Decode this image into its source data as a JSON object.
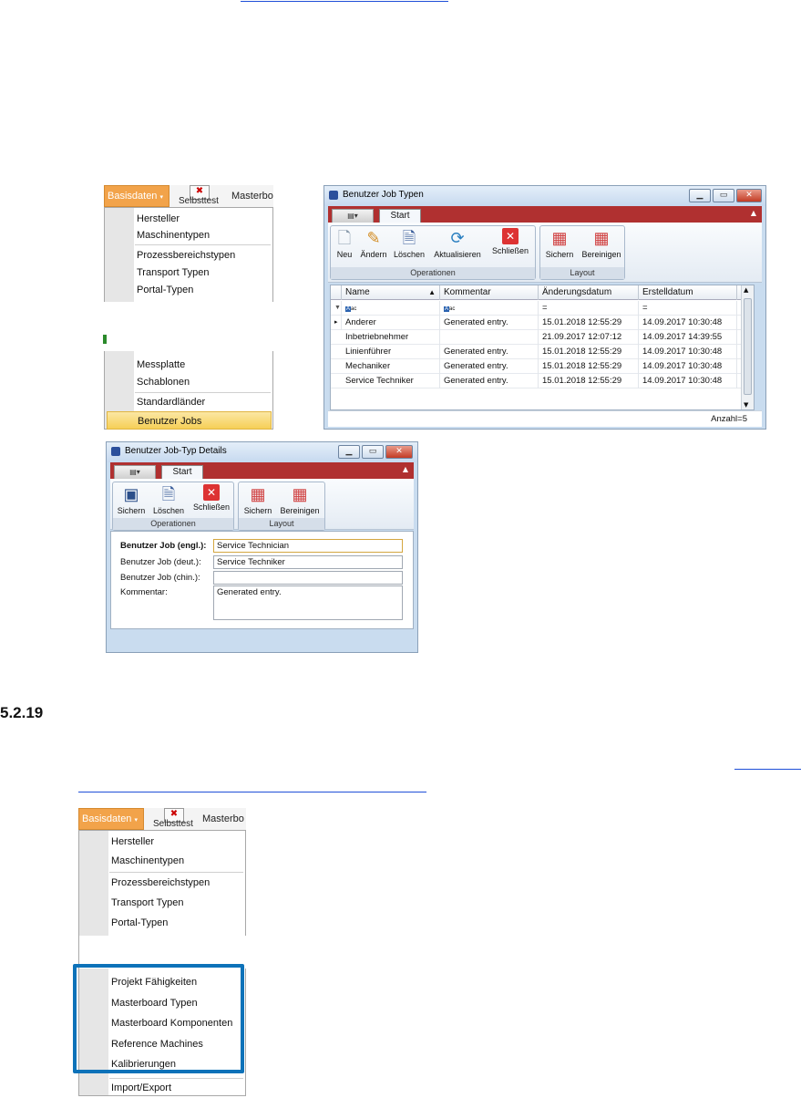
{
  "menu1": {
    "basisdaten_label": "Basisdaten",
    "selbsttest_label": "Selbsttest",
    "masterbo_label": "Masterbo",
    "items_top": [
      "Hersteller",
      "Maschinentypen"
    ],
    "items_mid": [
      "Prozessbereichstypen",
      "Transport Typen",
      "Portal-Typen"
    ],
    "items_low": [
      "Messplatte",
      "Schablonen"
    ],
    "items_bottom": [
      "Standardländer",
      "Benutzer Jobs"
    ]
  },
  "win1": {
    "title": "Benutzer Job Typen",
    "tab": "Start",
    "toolbar": {
      "buttons": [
        "Neu",
        "Ändern",
        "Löschen",
        "Aktualisieren",
        "Schließen"
      ],
      "group1": "Operationen",
      "layout_buttons": [
        "Sichern",
        "Bereinigen"
      ],
      "group2": "Layout"
    },
    "columns": [
      "Name",
      "Kommentar",
      "Änderungsdatum",
      "Erstelldatum"
    ],
    "filter": [
      "=",
      "="
    ],
    "rows": [
      [
        "Anderer",
        "Generated entry.",
        "15.01.2018 12:55:29",
        "14.09.2017 10:30:48"
      ],
      [
        "Inbetriebnehmer",
        "",
        "21.09.2017 12:07:12",
        "14.09.2017 14:39:55"
      ],
      [
        "Linienführer",
        "Generated entry.",
        "15.01.2018 12:55:29",
        "14.09.2017 10:30:48"
      ],
      [
        "Mechaniker",
        "Generated entry.",
        "15.01.2018 12:55:29",
        "14.09.2017 10:30:48"
      ],
      [
        "Service Techniker",
        "Generated entry.",
        "15.01.2018 12:55:29",
        "14.09.2017 10:30:48"
      ]
    ],
    "count": "Anzahl=5"
  },
  "win2": {
    "title": "Benutzer Job-Typ Details",
    "tab": "Start",
    "buttons": [
      "Sichern",
      "Löschen",
      "Schließen"
    ],
    "group1": "Operationen",
    "layout_buttons": [
      "Sichern",
      "Bereinigen"
    ],
    "group2": "Layout",
    "fields": {
      "engl_label": "Benutzer Job  (engl.):",
      "engl_value": "Service Technician",
      "deut_label": "Benutzer Job  (deut.):",
      "deut_value": "Service Techniker",
      "chin_label": "Benutzer Job  (chin.):",
      "chin_value": "",
      "komm_label": "Kommentar:",
      "komm_value": "Generated entry."
    }
  },
  "section_heading": "5.2.19",
  "menu2": {
    "basisdaten_label": "Basisdaten",
    "selbsttest_label": "Selbsttest",
    "masterbo_label": "Masterbo",
    "items_top": [
      "Hersteller",
      "Maschinentypen"
    ],
    "items_mid": [
      "Prozessbereichstypen",
      "Transport Typen",
      "Portal-Typen"
    ],
    "items_low": [
      "Projekt Fähigkeiten"
    ],
    "items_boxed": [
      "Masterboard Typen",
      "Masterboard Komponenten",
      "Reference Machines",
      "Kalibrierungen"
    ],
    "items_bottom": [
      "Import/Export"
    ]
  },
  "colors": {
    "accent_red": "#b03030",
    "menu_orange": "#f2a34a",
    "highlight_blue": "#0d72b9",
    "link_blue": "#1f4fd8"
  }
}
